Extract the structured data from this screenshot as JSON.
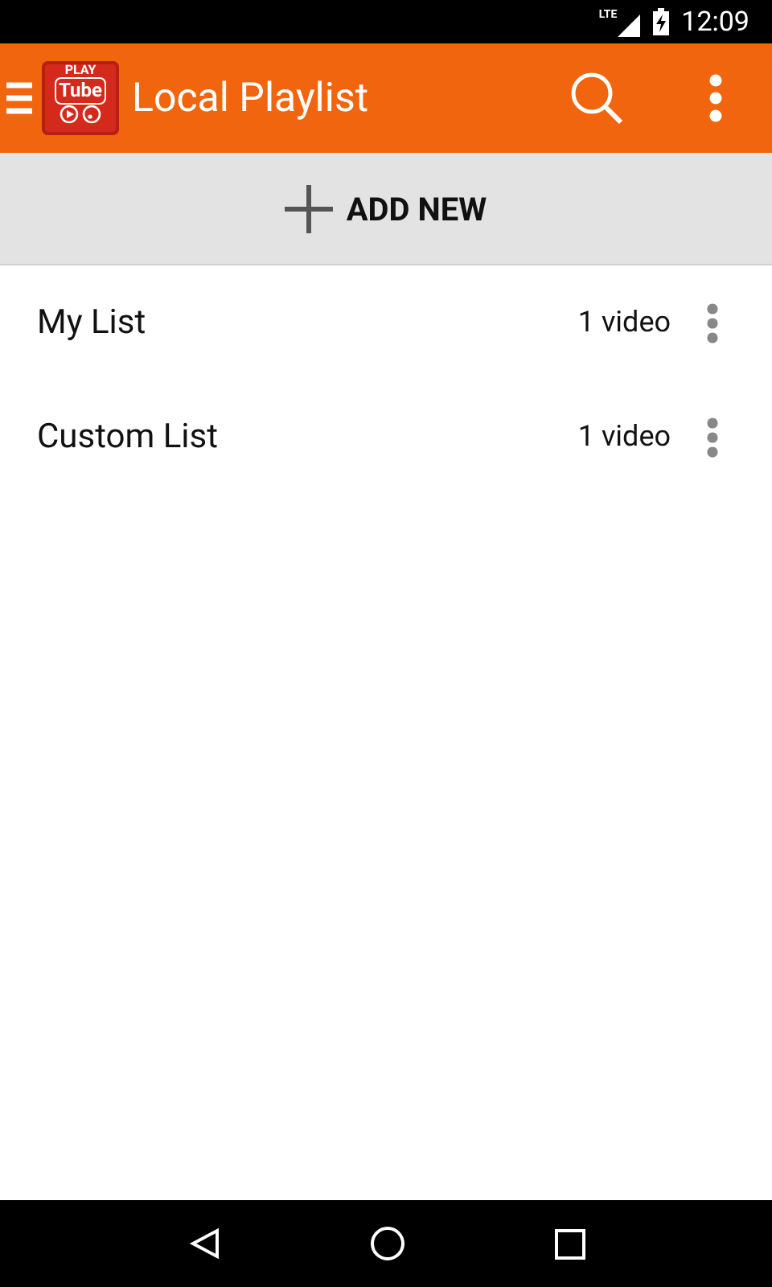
{
  "status_bar": {
    "network": "LTE",
    "time": "12:09"
  },
  "app_bar": {
    "logo": {
      "top": "PLAY",
      "main": "Tube"
    },
    "title": "Local Playlist"
  },
  "add_button": {
    "label": "ADD NEW"
  },
  "playlists": [
    {
      "name": "My List",
      "count": "1 video"
    },
    {
      "name": "Custom List",
      "count": "1 video"
    }
  ]
}
